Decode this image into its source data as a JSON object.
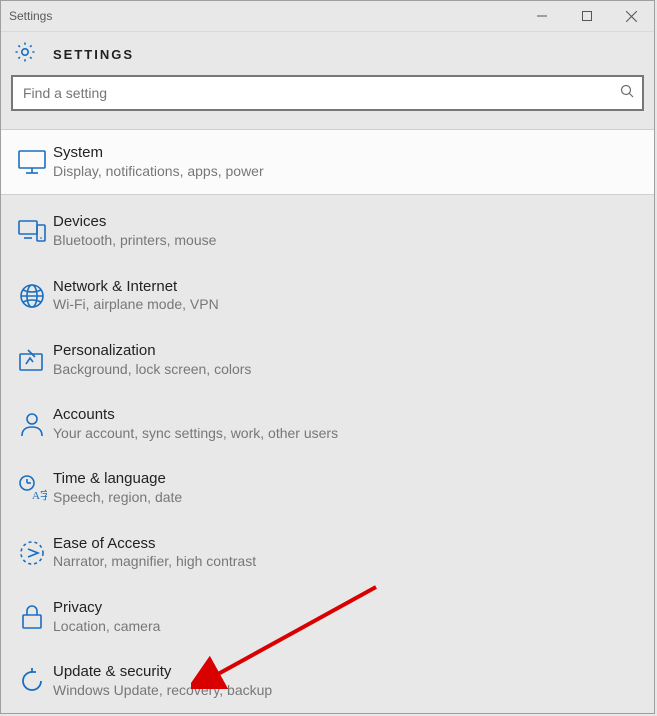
{
  "window": {
    "title": "Settings"
  },
  "header": {
    "label": "SETTINGS"
  },
  "search": {
    "placeholder": "Find a setting"
  },
  "items": [
    {
      "title": "System",
      "subtitle": "Display, notifications, apps, power"
    },
    {
      "title": "Devices",
      "subtitle": "Bluetooth, printers, mouse"
    },
    {
      "title": "Network & Internet",
      "subtitle": "Wi-Fi, airplane mode, VPN"
    },
    {
      "title": "Personalization",
      "subtitle": "Background, lock screen, colors"
    },
    {
      "title": "Accounts",
      "subtitle": "Your account, sync settings, work, other users"
    },
    {
      "title": "Time & language",
      "subtitle": "Speech, region, date"
    },
    {
      "title": "Ease of Access",
      "subtitle": "Narrator, magnifier, high contrast"
    },
    {
      "title": "Privacy",
      "subtitle": "Location, camera"
    },
    {
      "title": "Update & security",
      "subtitle": "Windows Update, recovery, backup"
    }
  ]
}
